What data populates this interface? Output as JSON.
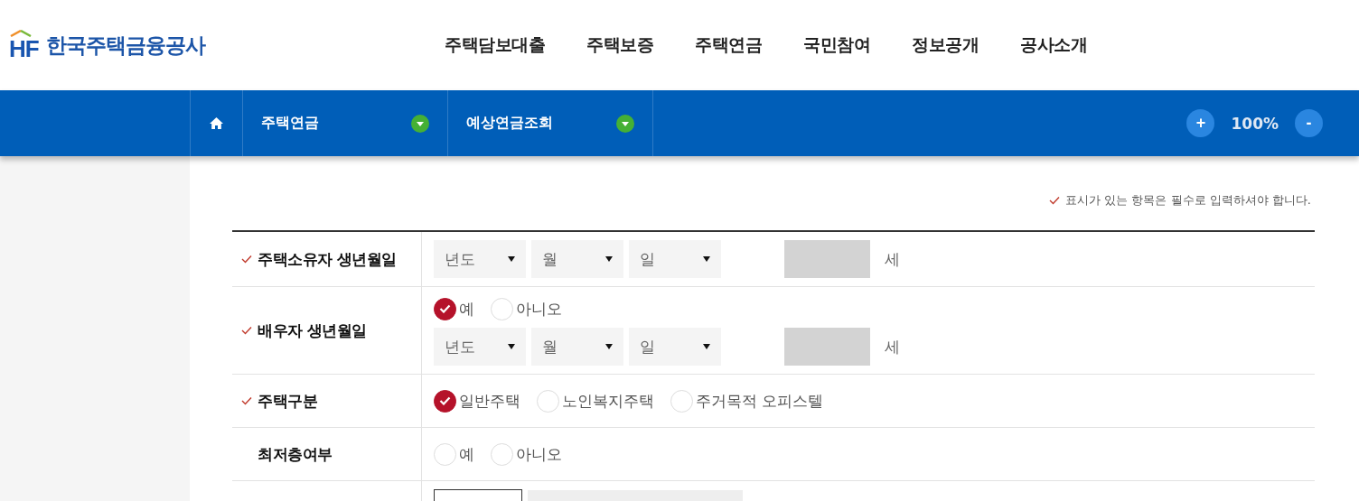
{
  "header": {
    "logo": {
      "mark": "HF",
      "name": "한국주택금융공사"
    },
    "nav": [
      {
        "label": "주택담보대출"
      },
      {
        "label": "주택보증"
      },
      {
        "label": "주택연금"
      },
      {
        "label": "국민참여"
      },
      {
        "label": "정보공개"
      },
      {
        "label": "공사소개"
      }
    ]
  },
  "breadcrumb": {
    "items": [
      {
        "label": "주택연금"
      },
      {
        "label": "예상연금조회"
      }
    ],
    "zoom": {
      "plus": "+",
      "value": "100%",
      "minus": "-"
    }
  },
  "form": {
    "required_note": "표시가 있는 항목은 필수로 입력하셔야 합니다.",
    "rows": [
      {
        "kind": "date",
        "label": "주택소유자 생년월일",
        "required": true,
        "selects": [
          "년도",
          "월",
          "일"
        ],
        "age_unit": "세"
      },
      {
        "kind": "choice_date",
        "label": "배우자 생년월일",
        "required": true,
        "radios": [
          {
            "label": "예",
            "selected": true
          },
          {
            "label": "아니오",
            "selected": false
          }
        ],
        "selects": [
          "년도",
          "월",
          "일"
        ],
        "age_unit": "세"
      },
      {
        "kind": "choice",
        "label": "주택구분",
        "required": true,
        "radios": [
          {
            "label": "일반주택",
            "selected": true
          },
          {
            "label": "노인복지주택",
            "selected": false
          },
          {
            "label": "주거목적 오피스텔",
            "selected": false
          }
        ]
      },
      {
        "kind": "choice",
        "label": "최저층여부",
        "required": false,
        "radios": [
          {
            "label": "예",
            "selected": false
          },
          {
            "label": "아니오",
            "selected": false
          }
        ]
      },
      {
        "kind": "partial"
      }
    ]
  }
}
